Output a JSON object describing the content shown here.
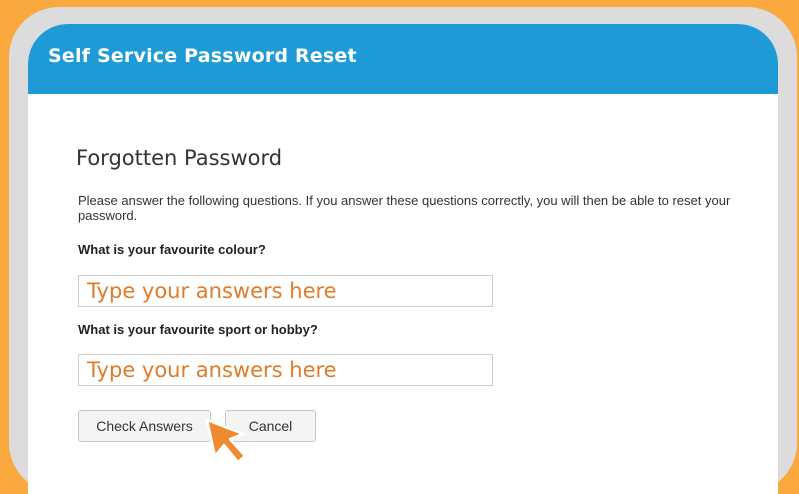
{
  "header": {
    "title": "Self Service Password Reset"
  },
  "page": {
    "title": "Forgotten Password",
    "instructions": "Please answer the following questions. If you answer these questions correctly, you will then be able to reset your password."
  },
  "questions": [
    {
      "label": "What is your favourite colour?",
      "value": "",
      "placeholder": "Type your answers here"
    },
    {
      "label": "What is your favourite sport or hobby?",
      "value": "",
      "placeholder": "Type your answers here"
    }
  ],
  "buttons": {
    "check": "Check Answers",
    "cancel": "Cancel"
  },
  "colors": {
    "background": "#F9A93E",
    "header": "#1E9BD7",
    "placeholder_text": "#E07B2A",
    "cursor": "#F08A2E"
  },
  "icons": {
    "cursor": "mouse-pointer-arrow-icon"
  }
}
